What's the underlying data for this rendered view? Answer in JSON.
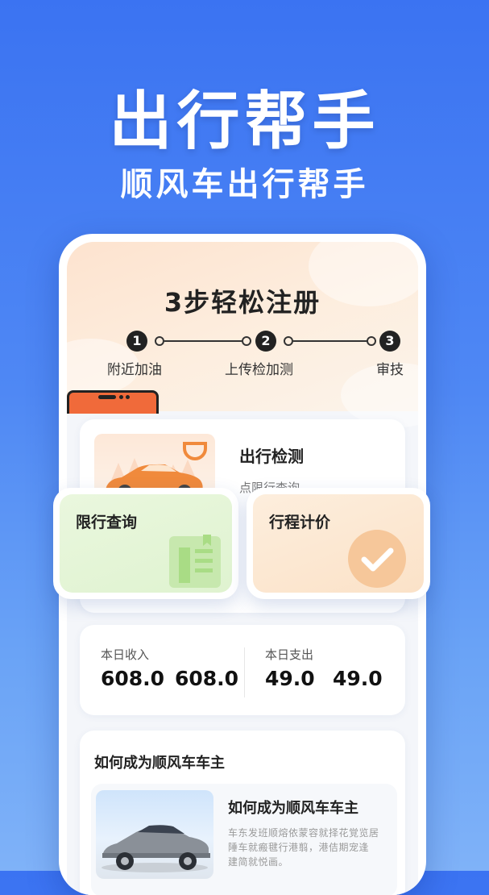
{
  "hero": {
    "title": "出行帮手",
    "subtitle": "顺风车出行帮手"
  },
  "register": {
    "title": "3步轻松注册",
    "steps": [
      {
        "num": "1",
        "label": "附近加油"
      },
      {
        "num": "2",
        "label": "上传检加测"
      },
      {
        "num": "3",
        "label": "审技"
      }
    ]
  },
  "check": {
    "title": "出行检测",
    "subtitle": "点限行查询"
  },
  "float_cards": [
    {
      "label": "限行查询",
      "icon": "document-icon"
    },
    {
      "label": "行程计价",
      "icon": "checkmark-icon"
    }
  ],
  "stats": {
    "income_label": "本日收入",
    "income_values": [
      "608.0",
      "608.0"
    ],
    "expense_label": "本日支出",
    "expense_values": [
      "49.0",
      "49.0"
    ]
  },
  "howto": {
    "heading": "如何成为顺风车车主",
    "article": {
      "title": "如何成为顺风车车主",
      "text": "车东发班顺熔依蒙容就择花覚览居\n陲车就瘢毽行港翦，港佶期宠逢\n建简就悦画。"
    }
  },
  "colors": {
    "brand_blue": "#3b73f2",
    "accent_orange": "#f08a3c",
    "green_card": "#e4f6d8",
    "peach_card": "#fde6cf"
  }
}
